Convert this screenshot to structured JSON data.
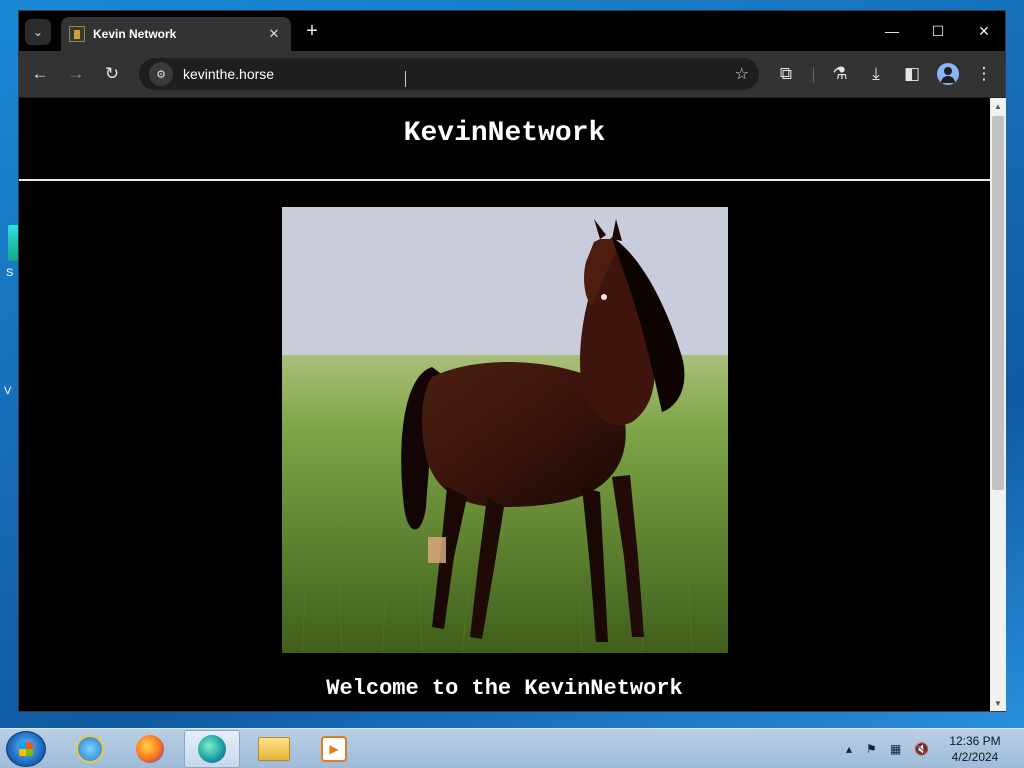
{
  "browser": {
    "tab_title": "Kevin Network",
    "url": "kevinthe.horse",
    "new_tab_label": "+",
    "close_tab_glyph": "✕"
  },
  "page": {
    "heading": "KevinNetwork",
    "welcome": "Welcome to the KevinNetwork",
    "hero_image": "horse-photo"
  },
  "desktop": {
    "icon_label_fragment": "S",
    "fragment2": "V"
  },
  "taskbar": {
    "apps": [
      "internet-explorer-icon",
      "firefox-icon",
      "browser-icon",
      "file-explorer-icon",
      "media-player-icon"
    ],
    "time": "12:36 PM",
    "date": "4/2/2024"
  },
  "colors": {
    "page_bg": "#000000",
    "title_text": "#ffffff",
    "toolbar": "#333333",
    "tabstrip": "#000000"
  }
}
